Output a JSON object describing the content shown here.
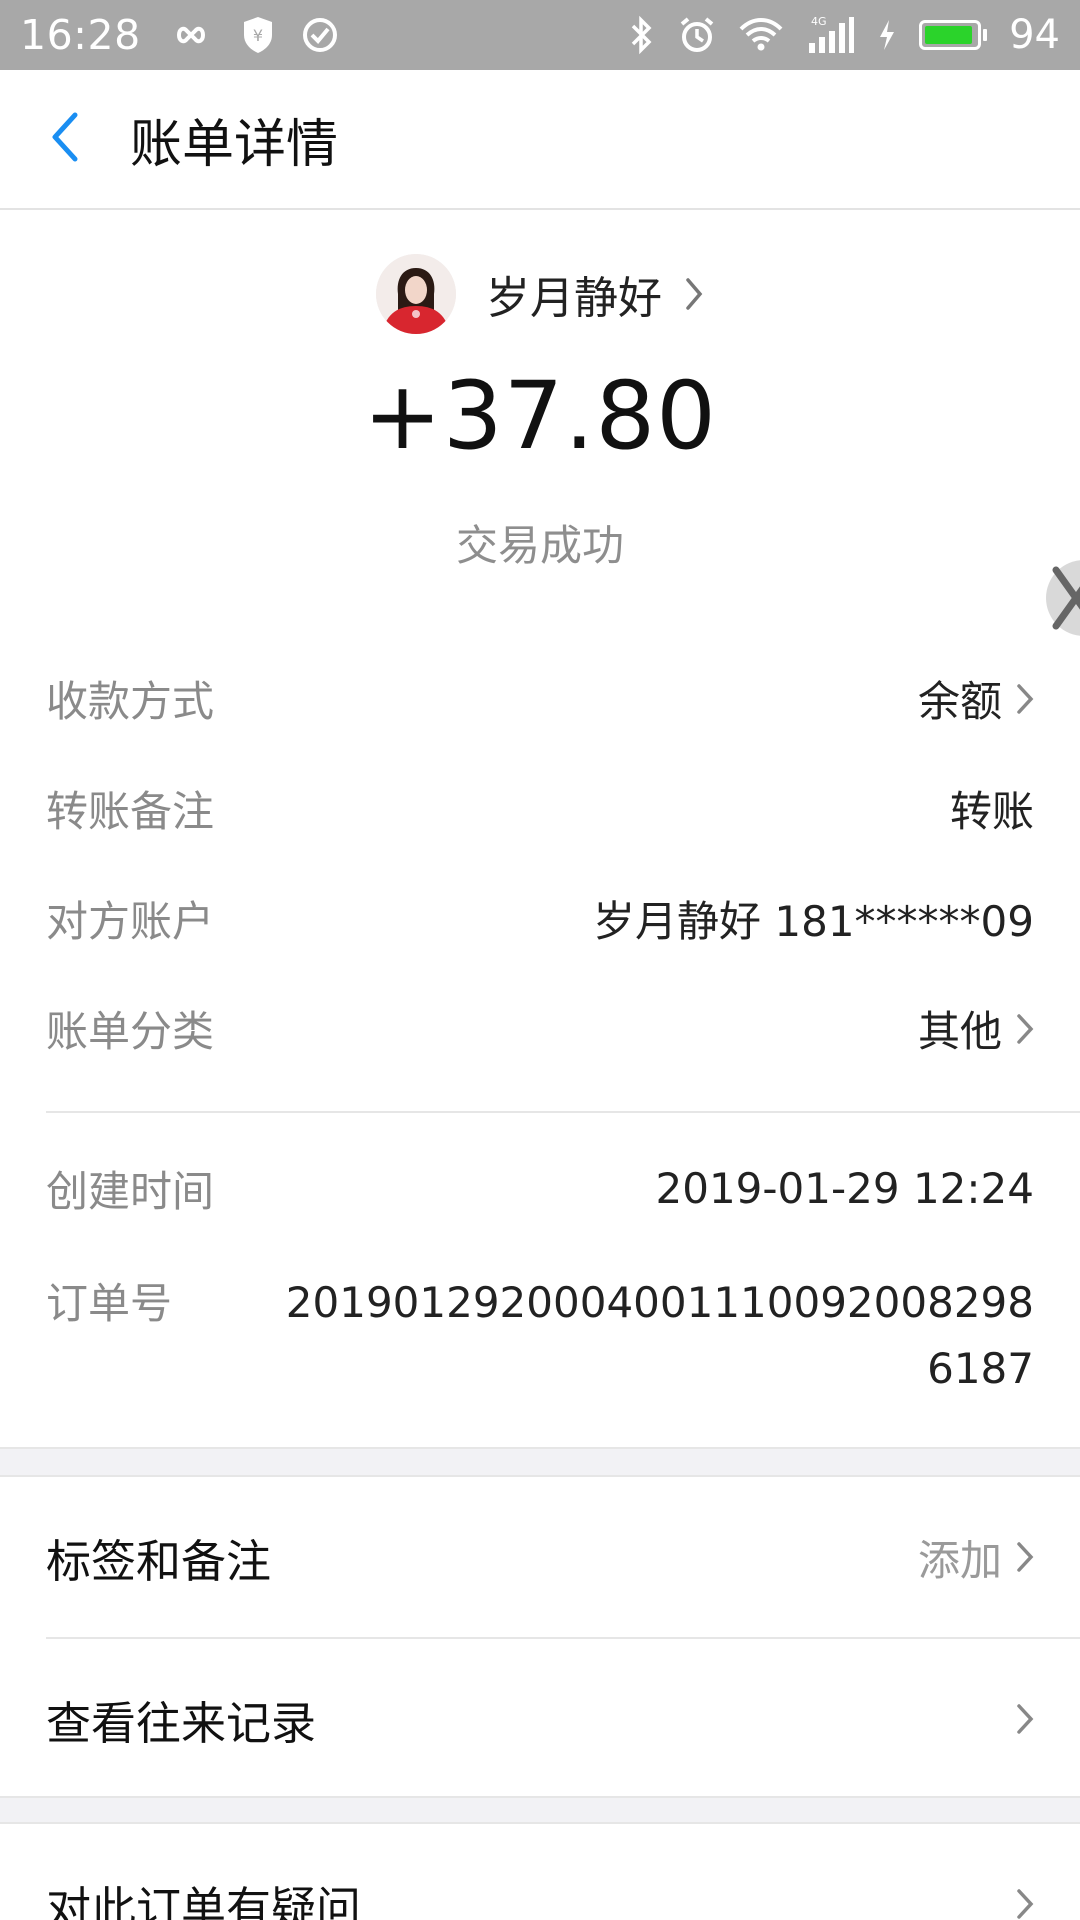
{
  "status_bar": {
    "time": "16:28",
    "battery_level": "94",
    "battery_fill_percent": 94,
    "icons": [
      "infinity-icon",
      "shield-yen-icon",
      "check-circle-icon",
      "bluetooth-icon",
      "alarm-icon",
      "wifi-icon",
      "signal-4g-icon",
      "charging-icon",
      "battery-icon"
    ]
  },
  "header": {
    "title": "账单详情",
    "back_icon": "chevron-left-icon",
    "accent_color": "#1a8ef2"
  },
  "summary": {
    "payer_name": "岁月静好",
    "amount": "+37.80",
    "status": "交易成功"
  },
  "details": {
    "rows": [
      {
        "label": "收款方式",
        "value": "余额",
        "has_chevron": true
      },
      {
        "label": "转账备注",
        "value": "转账",
        "has_chevron": false
      },
      {
        "label": "对方账户",
        "value": "岁月静好 181******09",
        "has_chevron": false
      },
      {
        "label": "账单分类",
        "value": "其他",
        "has_chevron": true
      }
    ],
    "created_label": "创建时间",
    "created_value": "2019-01-29 12:24",
    "order_label": "订单号",
    "order_value": "2019012920004001110092008298 6187"
  },
  "actions": {
    "tags_label": "标签和备注",
    "tags_value": "添加",
    "history_label": "查看往来记录",
    "question_label": "对此订单有疑问"
  }
}
